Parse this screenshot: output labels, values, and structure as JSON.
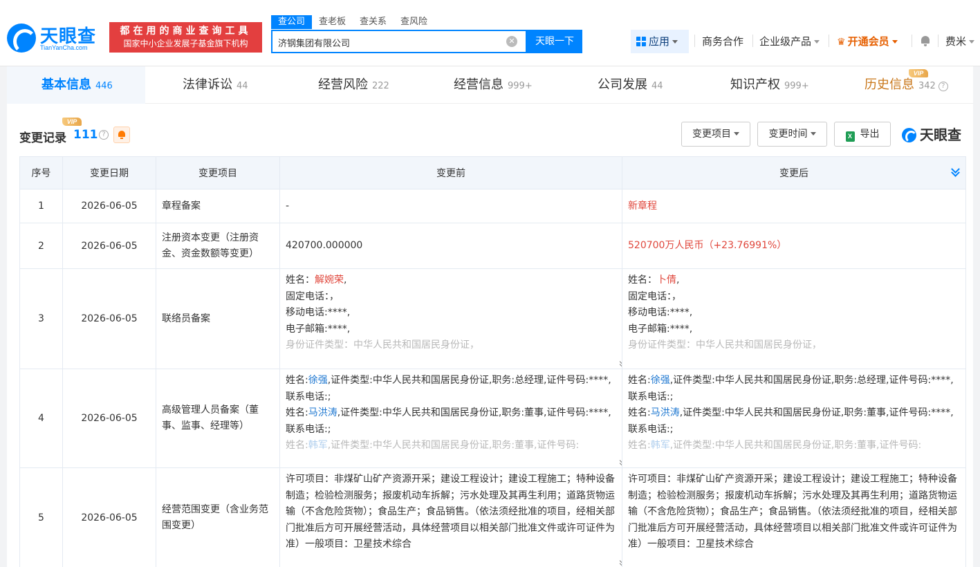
{
  "header": {
    "logo_text": "天眼查",
    "logo_sub": "TianYanCha.com",
    "slogan_line1": "都在用的商业查询工具",
    "slogan_line2": "国家中小企业发展子基金旗下机构",
    "search_tabs": [
      "查公司",
      "查老板",
      "查关系",
      "查风险"
    ],
    "search_value": "济钢集团有限公司",
    "search_button": "天眼一下",
    "nav_app": "应用",
    "nav_business": "商务合作",
    "nav_enterprise": "企业级产品",
    "nav_vip": "开通会员",
    "nav_user": "费米",
    "clear_glyph": "✕"
  },
  "tabs": [
    {
      "label": "基本信息",
      "count": "446"
    },
    {
      "label": "法律诉讼",
      "count": "44"
    },
    {
      "label": "经营风险",
      "count": "222"
    },
    {
      "label": "经营信息",
      "count": "999+"
    },
    {
      "label": "公司发展",
      "count": "44"
    },
    {
      "label": "知识产权",
      "count": "999+"
    },
    {
      "label": "历史信息",
      "count": "342"
    }
  ],
  "vip_label": "VIP",
  "section": {
    "title": "变更记录",
    "count": "111",
    "filter_item": "变更项目",
    "filter_time": "变更时间",
    "export": "导出",
    "brand": "天眼查"
  },
  "table": {
    "headers": [
      "序号",
      "变更日期",
      "变更项目",
      "变更前",
      "变更后"
    ],
    "rows": [
      {
        "no": "1",
        "date": "2026-06-05",
        "item": "章程备案",
        "before": "-",
        "after": "新章程"
      },
      {
        "no": "2",
        "date": "2026-06-05",
        "item": "注册资本变更（注册资金、资金数额等变更）",
        "before": "420700.000000",
        "after": "520700万人民币（+23.76991%）"
      },
      {
        "no": "3",
        "date": "2026-06-05",
        "item": "联络员备案",
        "before": {
          "name_label": "姓名：",
          "name": "解婉荣",
          "phone": "固定电话：，",
          "mobile": "移动电话:****,",
          "email": "电子邮箱:****,",
          "id_type": "身份证件类型：中华人民共和国居民身份证，"
        },
        "after": {
          "name_label": "姓名：",
          "name": "卜倩",
          "phone": "固定电话：，",
          "mobile": "移动电话:****,",
          "email": "电子邮箱:****,",
          "id_type": "身份证件类型：中华人民共和国居民身份证，"
        }
      },
      {
        "no": "4",
        "date": "2026-06-05",
        "item": "高级管理人员备案（董事、监事、经理等）",
        "before": {
          "p1_name": "徐强",
          "p1_rest": ",证件类型:中华人民共和国居民身份证,职务:总经理,证件号码:****,联系电话:;",
          "p2_name": "马洪涛",
          "p2_rest": ",证件类型:中华人民共和国居民身份证,职务:董事,证件号码:****,联系电话:;",
          "p3_name": "韩军",
          "p3_rest": ",证件类型:中华人民共和国居民身份证,职务:董事,证件号码:"
        },
        "after": {
          "p1_name": "徐强",
          "p1_rest": ",证件类型:中华人民共和国居民身份证,职务:总经理,证件号码:****,联系电话:;",
          "p2_name": "马洪涛",
          "p2_rest": ",证件类型:中华人民共和国居民身份证,职务:董事,证件号码:****,联系电话:;",
          "p3_name": "韩军",
          "p3_rest": ",证件类型:中华人民共和国居民身份证,职务:董事,证件号码:"
        },
        "name_label": "姓名:"
      },
      {
        "no": "5",
        "date": "2026-06-05",
        "item": "经营范围变更（含业务范围变更）",
        "before": "许可项目：非煤矿山矿产资源开采；建设工程设计；建设工程施工；特种设备制造；检验检测服务；报废机动车拆解；污水处理及其再生利用；道路货物运输（不含危险货物）；食品生产；食品销售。（依法须经批准的项目，经相关部门批准后方可开展经营活动，具体经营项目以相关部门批准文件或许可证件为准）一般项目：卫星技术综合",
        "after": "许可项目：非煤矿山矿产资源开采；建设工程设计；建设工程施工；特种设备制造；检验检测服务；报废机动车拆解；污水处理及其再生利用；道路货物运输（不含危险货物）；食品生产；食品销售。（依法须经批准的项目，经相关部门批准后方可开展经营活动，具体经营项目以相关部门批准文件或许可证件为准）一般项目：卫星技术综合"
      }
    ]
  }
}
